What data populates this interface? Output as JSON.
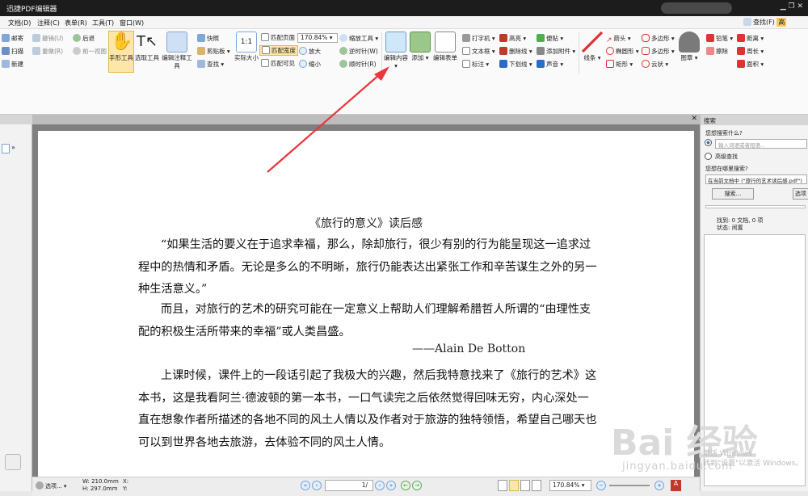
{
  "app": {
    "title": "迅捷PDF编辑器"
  },
  "menu": {
    "items": [
      "文档(D)",
      "注释(C)",
      "表单(R)",
      "工具(T)",
      "窗口(W)"
    ],
    "right": "查找(F)",
    "right2": "高"
  },
  "ribbon": {
    "mail": "邮寄",
    "scan": "扫描",
    "new": "新建",
    "undo": "撤销(U)",
    "redo": "重做(R)",
    "back": "后退",
    "forward": "前一视图",
    "hand": "手形工具",
    "select": "选取工具",
    "annotate": "编辑注释工具",
    "snapshot": "快照",
    "clipboard": "剪贴板",
    "find": "查找",
    "actual": "实际大小",
    "fit_page": "匹配页面",
    "fit_width": "匹配宽度",
    "fit_visible": "匹配可见",
    "zoom": "170.84%",
    "zoom_tool": "缩放工具",
    "zoom_in": "放大",
    "zoom_out": "缩小",
    "rot_ccw": "逆时针(W)",
    "rot_cw": "顺时针(R)",
    "edit_content": "编辑内容",
    "add": "添加",
    "edit_form": "编辑表单",
    "typewriter": "打字机",
    "textbox": "文本框",
    "callout": "标注",
    "highlight": "高亮",
    "strike": "删除线",
    "underline": "下划线",
    "note": "便贴",
    "attach": "添加附件",
    "sound": "声音",
    "line": "线条",
    "arrow": "箭头",
    "ellipse": "椭圆形",
    "rect": "矩形",
    "polygon": "多边形",
    "polyline": "多边形",
    "cloud": "云状",
    "stamp": "图章",
    "pencil": "铅笔",
    "eraser": "擦除",
    "distance": "距离",
    "perimeter": "周长",
    "area": "面积"
  },
  "document": {
    "title": "《旅行的意义》读后感",
    "p1": "“如果生活的要义在于追求幸福，那么，除却旅行，很少有别的行为能呈现这一追求过程中的热情和矛盾。无论是多么的不明晰，旅行仍能表达出紧张工作和辛苦谋生之外的另一种生活意义。”",
    "p2": "而且，对旅行的艺术的研究可能在一定意义上帮助人们理解希腊哲人所谓的“由理性支配的积极生活所带来的幸福”或人类昌盛。",
    "signature": "——Alain De Botton",
    "p3": "上课时候，课件上的一段话引起了我极大的兴趣，然后我特意找来了《旅行的艺术》这本书，这是我看阿兰·德波顿的第一本书，一口气读完之后依然觉得回味无穷，内心深处一直在想象作者所描述的各地不同的风土人情以及作者对于旅游的独特领悟，希望自己哪天也可以到世界各地去旅游，去体验不同的风土人情。"
  },
  "search": {
    "panel_title": "搜索",
    "question": "您想搜索什么?",
    "placeholder": "输入词语或者短语...",
    "advanced": "高级查找",
    "where": "您想在哪里搜索?",
    "scope": "在当前文档中 (\"旅行的艺术读后感.pdf\")",
    "button": "搜索...",
    "button2": "选项",
    "found": "找到: 0 文档, 0 项",
    "status": "状态: 闲置"
  },
  "status": {
    "options": "选项...",
    "width": "W: 210.0mm",
    "height": "H: 297.0mm",
    "x": "X:",
    "y": "Y:",
    "page": "1/",
    "zoom": "170.84%"
  },
  "watermark": {
    "brand": "Bai 经验",
    "url": "jingyan.baidu.com",
    "win1": "激活 Windows",
    "win2": "转到\"设置\"以激活 Windows。"
  },
  "colors": {
    "accent": "#2b6cc4",
    "red_arrow": "#e8363b",
    "hand_active": "#fde7a8"
  }
}
